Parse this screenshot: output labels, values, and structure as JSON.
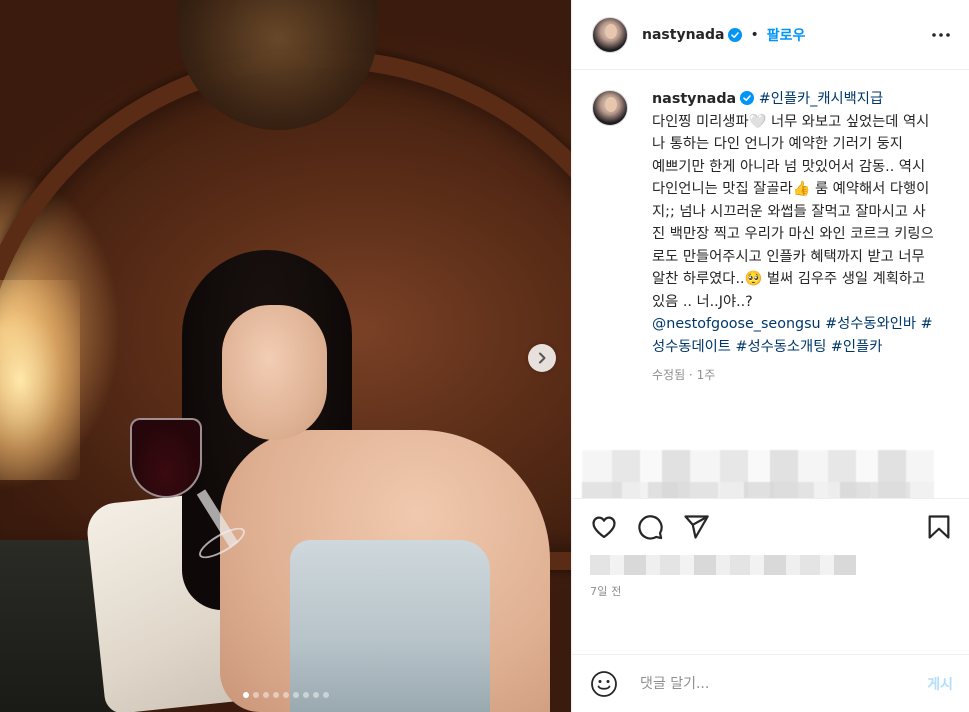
{
  "post": {
    "username": "nastynada",
    "follow_label": "팔로우",
    "separator": "•",
    "verified": true,
    "carousel": {
      "total": 9,
      "current": 1
    }
  },
  "caption": {
    "username": "nastynada",
    "segments": [
      {
        "type": "tag",
        "text": "#인플카_캐시백지급"
      },
      {
        "type": "text",
        "text": "\n다인찡 미리생파🤍 너무 와보고 싶었는데 역시나 통하는 다인 언니가 예약한 기러기 둥지\n예쁘기만 한게 아니라 넘 맛있어서 감동.. 역시 다인언니는 맛집 잘골라👍 룸 예약해서 다행이지;; 넘나 시끄러운 와썹들 잘먹고 잘마시고 사진 백만장 찍고 우리가 마신 와인 코르크 키링으로도 만들어주시고 인플카 혜택까지 받고 너무 알찬 하루였다..🥺 벌써 김우주 생일 계획하고있음 .. 너..J야..?\n"
      },
      {
        "type": "mention",
        "text": "@nestofgoose_seongsu"
      },
      {
        "type": "text",
        "text": " "
      },
      {
        "type": "tag",
        "text": "#성수동와인바"
      },
      {
        "type": "text",
        "text": " "
      },
      {
        "type": "tag",
        "text": "#성수동데이트"
      },
      {
        "type": "text",
        "text": " "
      },
      {
        "type": "tag",
        "text": "#성수동소개팅"
      },
      {
        "type": "text",
        "text": " "
      },
      {
        "type": "tag",
        "text": "#인플카"
      }
    ],
    "meta": "수정됨 · 1주"
  },
  "actions": {
    "like": "heart-icon",
    "comment": "comment-icon",
    "share": "share-icon",
    "save": "bookmark-icon"
  },
  "time_ago": "7일 전",
  "comment": {
    "placeholder": "댓글 달기...",
    "post_label": "게시"
  },
  "colors": {
    "link": "#00376b",
    "follow": "#0095f6",
    "post_button_disabled": "#b2dffc",
    "verified": "#0095f6"
  }
}
